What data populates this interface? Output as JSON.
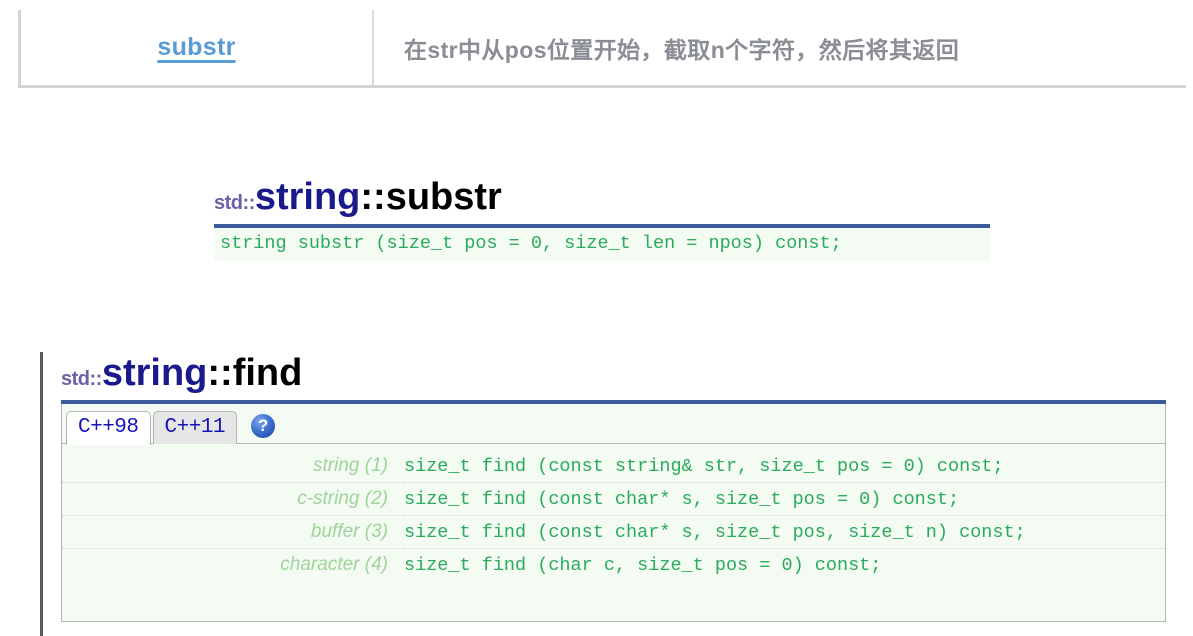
{
  "reference_table": {
    "rows": [
      {
        "name": "substr",
        "description": "在str中从pos位置开始，截取n个字符，然后将其返回"
      }
    ]
  },
  "substr_section": {
    "title": {
      "namespace": "std::",
      "class": "string",
      "separator": "::",
      "function": "substr"
    },
    "signature": "string substr (size_t pos = 0, size_t len = npos) const;"
  },
  "find_section": {
    "title": {
      "namespace": "std::",
      "class": "string",
      "separator": "::",
      "function": "find"
    },
    "tabs": [
      {
        "label": "C++98",
        "active": true
      },
      {
        "label": "C++11",
        "active": false
      }
    ],
    "help_icon": {
      "glyph": "?",
      "name": "help-icon"
    },
    "signatures": [
      {
        "label": "string (1)",
        "code": "size_t find (const string& str, size_t pos = 0) const;"
      },
      {
        "label": "c-string (2)",
        "code": "size_t find (const char* s, size_t pos = 0) const;"
      },
      {
        "label": "buffer (3)",
        "code": "size_t find (const char* s, size_t pos, size_t n) const;"
      },
      {
        "label": "character (4)",
        "code": "size_t find (char c, size_t pos = 0) const;"
      }
    ]
  },
  "colors": {
    "heading_rule": "#3b5a9c",
    "namespace_text": "#6b62a8",
    "class_text": "#1a1a8c",
    "code_text": "#2bab5c",
    "label_text": "#9ed49b",
    "link_text": "#5b9bd5",
    "description_text": "#8a8d93",
    "tab_text": "#1515b5",
    "code_background": "#f4fbf3"
  }
}
